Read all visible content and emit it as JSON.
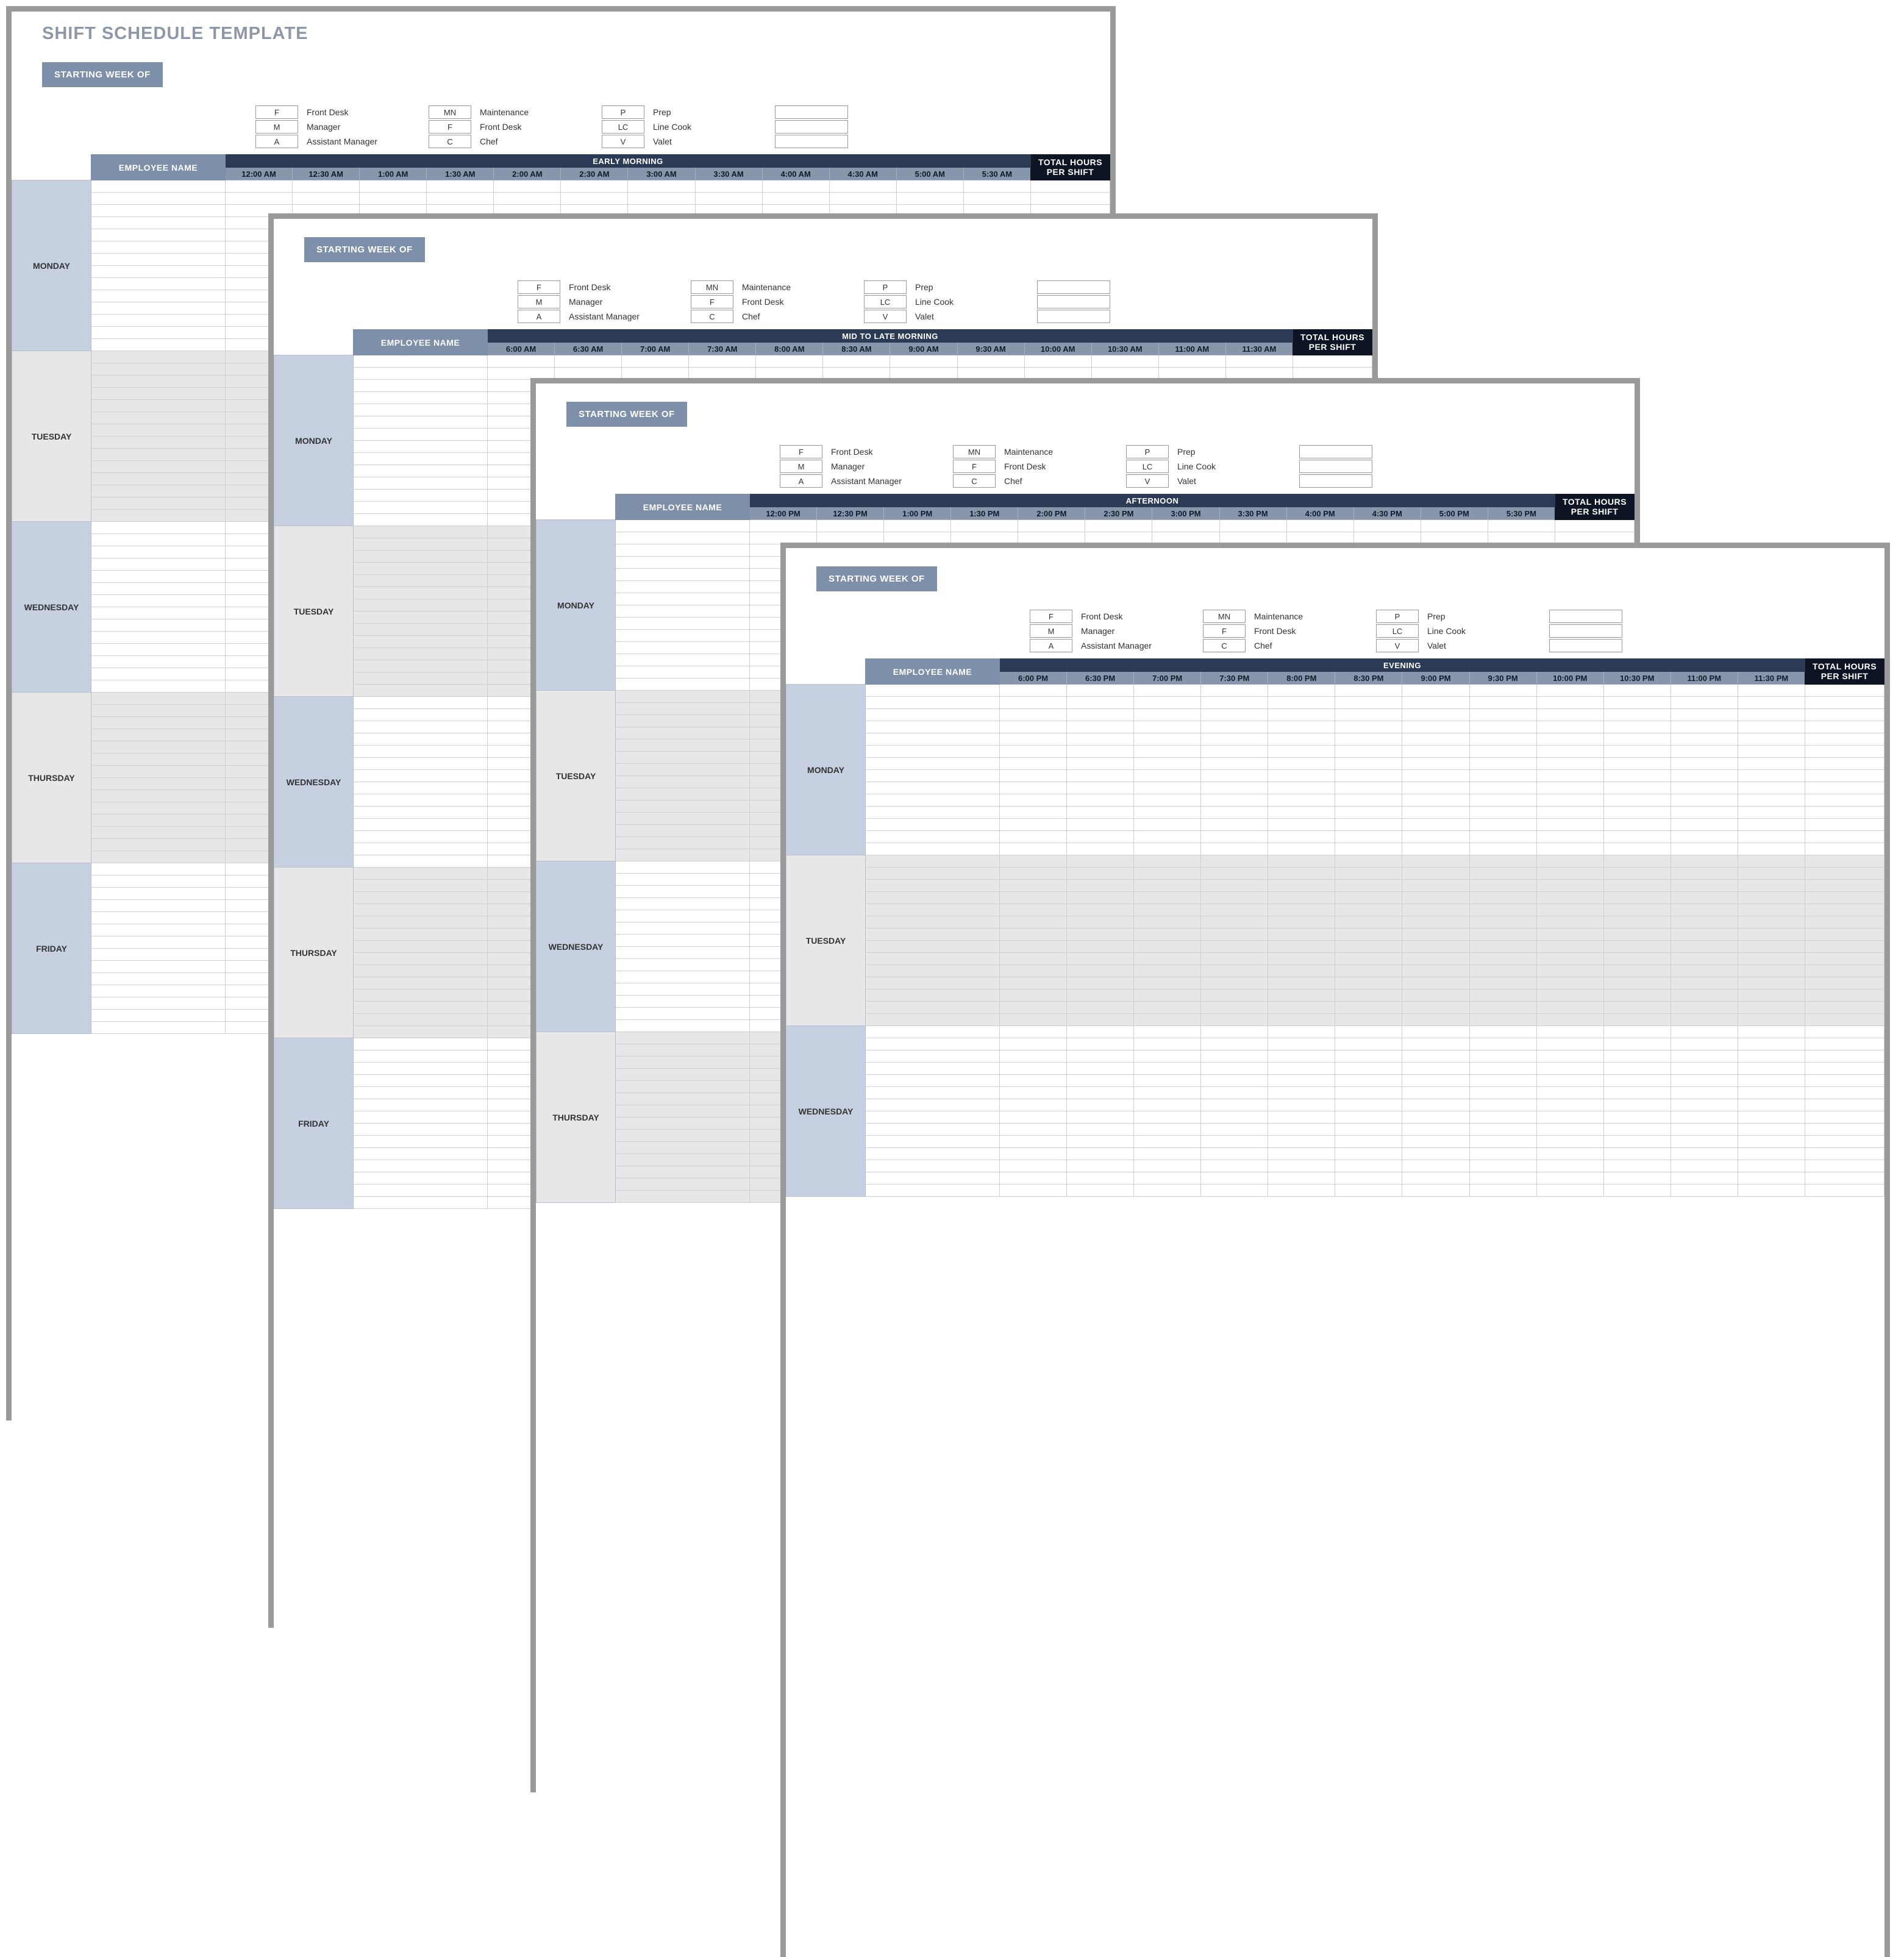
{
  "title": "SHIFT SCHEDULE TEMPLATE",
  "starting_week_label": "STARTING WEEK OF",
  "employee_name_label": "EMPLOYEE  NAME",
  "total_hours_label": "TOTAL HOURS PER SHIFT",
  "legend": [
    {
      "code": "F",
      "label": "Front Desk"
    },
    {
      "code": "M",
      "label": "Manager"
    },
    {
      "code": "A",
      "label": "Assistant Manager"
    },
    {
      "code": "MN",
      "label": "Maintenance"
    },
    {
      "code": "F",
      "label": "Front Desk"
    },
    {
      "code": "C",
      "label": "Chef"
    },
    {
      "code": "P",
      "label": "Prep"
    },
    {
      "code": "LC",
      "label": "Line Cook"
    },
    {
      "code": "V",
      "label": "Valet"
    }
  ],
  "days": [
    "MONDAY",
    "TUESDAY",
    "WEDNESDAY",
    "THURSDAY",
    "FRIDAY"
  ],
  "sheets": {
    "s1": {
      "shift_title": "EARLY MORNING",
      "times": [
        "12:00 AM",
        "12:30 AM",
        "1:00 AM",
        "1:30 AM",
        "2:00 AM",
        "2:30 AM",
        "3:00 AM",
        "3:30 AM",
        "4:00 AM",
        "4:30 AM",
        "5:00 AM",
        "5:30 AM"
      ],
      "days_visible": [
        "MONDAY",
        "TUESDAY",
        "WEDNESDAY",
        "THURSDAY",
        "FRIDAY"
      ],
      "rows_per_day": 14
    },
    "s2": {
      "shift_title": "MID TO LATE MORNING",
      "times": [
        "6:00 AM",
        "6:30 AM",
        "7:00 AM",
        "7:30 AM",
        "8:00 AM",
        "8:30 AM",
        "9:00 AM",
        "9:30 AM",
        "10:00 AM",
        "10:30 AM",
        "11:00 AM",
        "11:30 AM"
      ],
      "days_visible": [
        "MONDAY",
        "TUESDAY",
        "WEDNESDAY",
        "THURSDAY",
        "FRIDAY"
      ],
      "rows_per_day": 14
    },
    "s3": {
      "shift_title": "AFTERNOON",
      "times": [
        "12:00 PM",
        "12:30 PM",
        "1:00 PM",
        "1:30 PM",
        "2:00 PM",
        "2:30 PM",
        "3:00 PM",
        "3:30 PM",
        "4:00 PM",
        "4:30 PM",
        "5:00 PM",
        "5:30 PM"
      ],
      "days_visible": [
        "MONDAY",
        "TUESDAY",
        "WEDNESDAY",
        "THURSDAY"
      ],
      "rows_per_day": 14
    },
    "s4": {
      "shift_title": "EVENING",
      "times": [
        "6:00 PM",
        "6:30 PM",
        "7:00 PM",
        "7:30 PM",
        "8:00 PM",
        "8:30 PM",
        "9:00 PM",
        "9:30 PM",
        "10:00 PM",
        "10:30 PM",
        "11:00 PM",
        "11:30 PM"
      ],
      "days_visible": [
        "MONDAY",
        "TUESDAY",
        "WEDNESDAY"
      ],
      "rows_per_day": 14
    }
  }
}
